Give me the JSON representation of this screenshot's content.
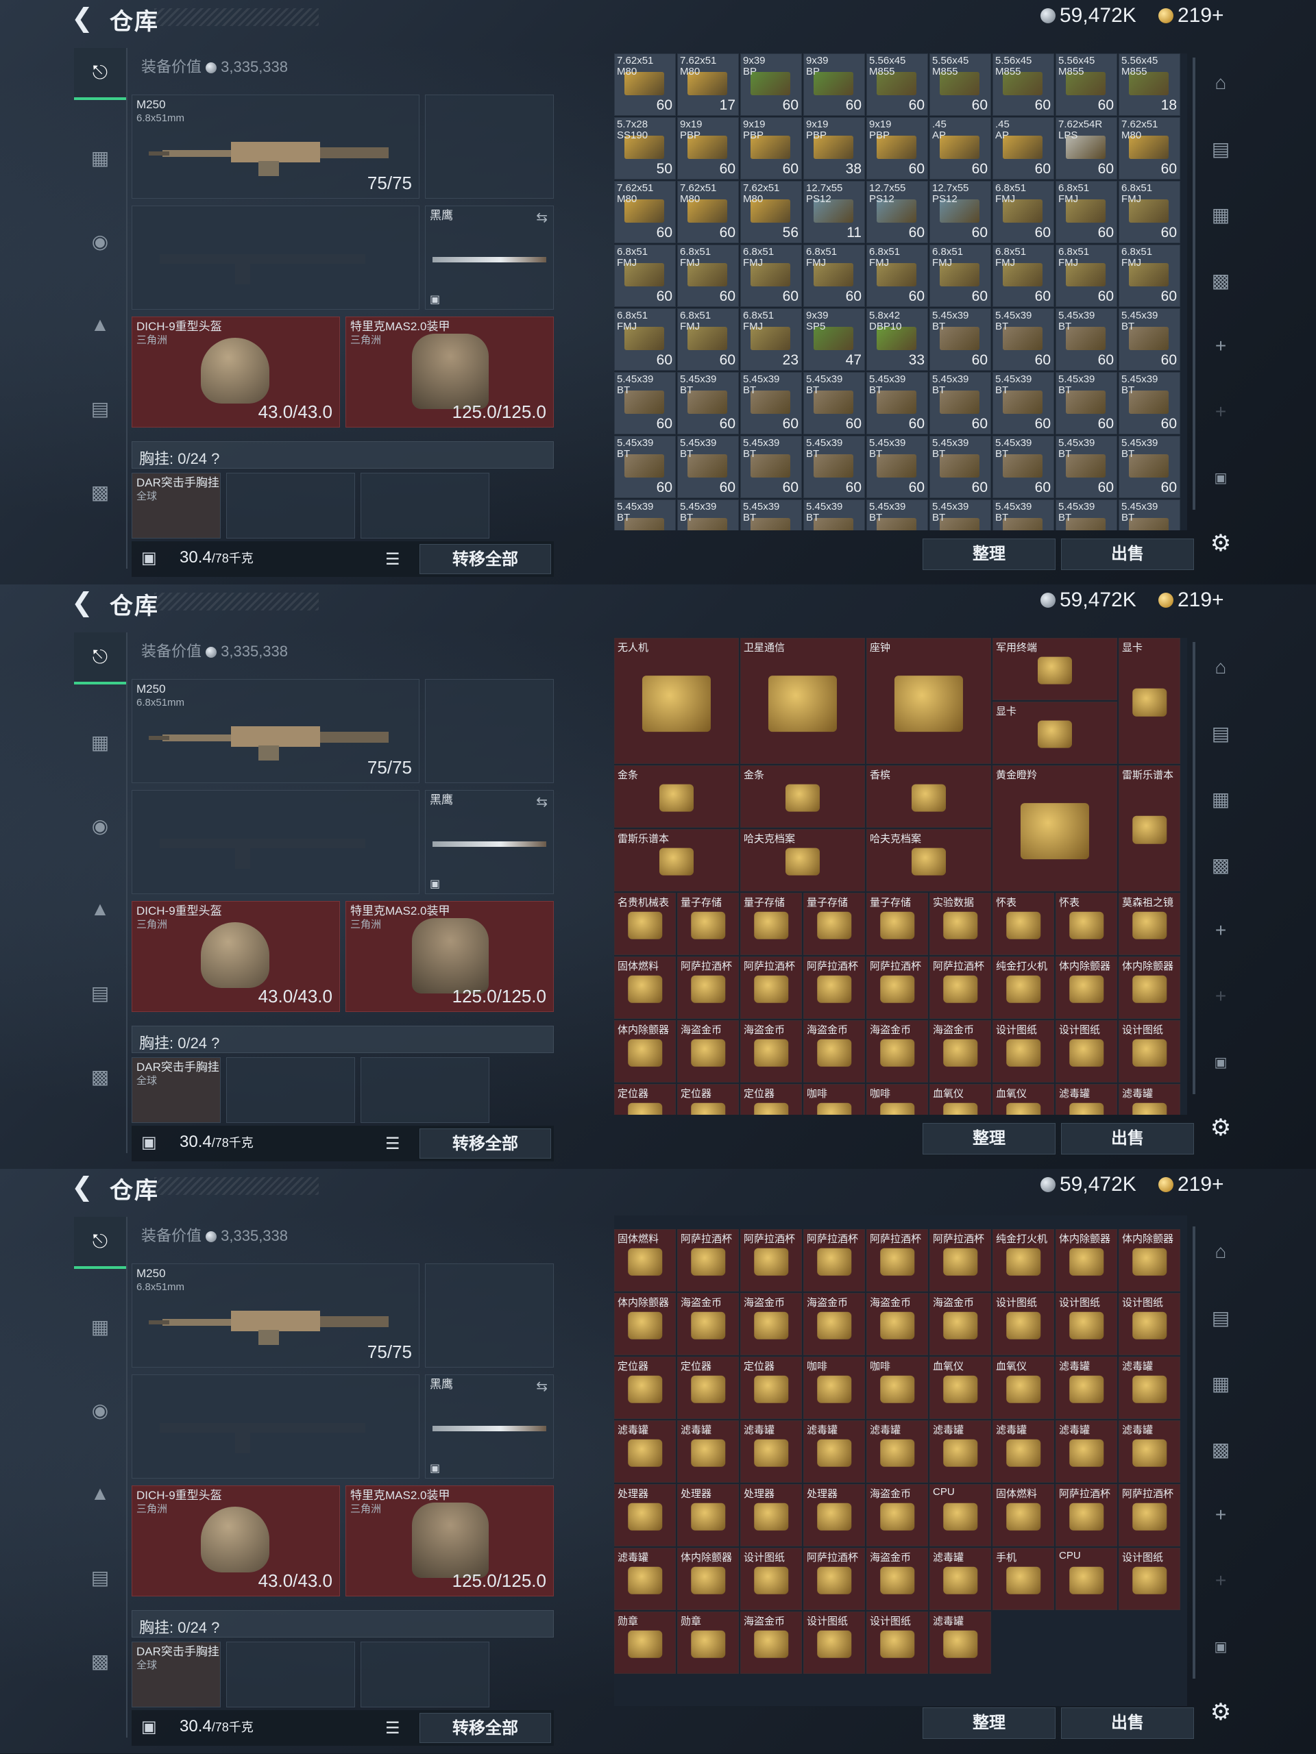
{
  "header": {
    "back_icon": "back-arrow-icon",
    "title": "仓库",
    "silver": "59,472K",
    "gold": "219+"
  },
  "equip": {
    "value_label": "装备价值",
    "value": "3,335,338",
    "primary": {
      "name": "M250",
      "caliber": "6.8x51mm",
      "ammo": "75/75"
    },
    "melee": {
      "name": "黑鹰"
    },
    "helmet": {
      "name": "DICH-9重型头盔",
      "region": "三角洲",
      "durability": "43.0/43.0"
    },
    "armor": {
      "name": "特里克MAS2.0装甲",
      "region": "三角洲",
      "durability": "125.0/125.0"
    },
    "chest_rig": "胸挂: 0/24",
    "chest_help": "?",
    "rig_item": {
      "name": "DAR突击手胸挂",
      "region": "全球"
    },
    "weight": "30.4",
    "weight_max": "/78千克",
    "transfer_all": "转移全部"
  },
  "actions": {
    "sort": "整理",
    "sell": "出售"
  },
  "ammo_grid": [
    [
      "7.62x51",
      "M80",
      60
    ],
    [
      "7.62x51",
      "M80",
      17
    ],
    [
      "9x39",
      "BP",
      60
    ],
    [
      "9x39",
      "BP",
      60
    ],
    [
      "5.56x45",
      "M855",
      60
    ],
    [
      "5.56x45",
      "M855",
      60
    ],
    [
      "5.56x45",
      "M855",
      60
    ],
    [
      "5.56x45",
      "M855",
      60
    ],
    [
      "5.56x45",
      "M855",
      18
    ],
    [
      "5.7x28",
      "SS190",
      50
    ],
    [
      "9x19",
      "PBP",
      60
    ],
    [
      "9x19",
      "PBP",
      60
    ],
    [
      "9x19",
      "PBP",
      38
    ],
    [
      "9x19",
      "PBP",
      60
    ],
    [
      ".45",
      "AP",
      60
    ],
    [
      ".45",
      "AP",
      60
    ],
    [
      "7.62x54R",
      "LPS",
      60
    ],
    [
      "7.62x51",
      "M80",
      60
    ],
    [
      "7.62x51",
      "M80",
      60
    ],
    [
      "7.62x51",
      "M80",
      60
    ],
    [
      "7.62x51",
      "M80",
      56
    ],
    [
      "12.7x55",
      "PS12",
      11
    ],
    [
      "12.7x55",
      "PS12",
      60
    ],
    [
      "12.7x55",
      "PS12",
      60
    ],
    [
      "6.8x51",
      "FMJ",
      60
    ],
    [
      "6.8x51",
      "FMJ",
      60
    ],
    [
      "6.8x51",
      "FMJ",
      60
    ],
    [
      "6.8x51",
      "FMJ",
      60
    ],
    [
      "6.8x51",
      "FMJ",
      60
    ],
    [
      "6.8x51",
      "FMJ",
      60
    ],
    [
      "6.8x51",
      "FMJ",
      60
    ],
    [
      "6.8x51",
      "FMJ",
      60
    ],
    [
      "6.8x51",
      "FMJ",
      60
    ],
    [
      "6.8x51",
      "FMJ",
      60
    ],
    [
      "6.8x51",
      "FMJ",
      60
    ],
    [
      "6.8x51",
      "FMJ",
      60
    ],
    [
      "6.8x51",
      "FMJ",
      60
    ],
    [
      "6.8x51",
      "FMJ",
      60
    ],
    [
      "6.8x51",
      "FMJ",
      23
    ],
    [
      "9x39",
      "SP5",
      47
    ],
    [
      "5.8x42",
      "DBP10",
      33
    ],
    [
      "5.45x39",
      "BT",
      60
    ],
    [
      "5.45x39",
      "BT",
      60
    ],
    [
      "5.45x39",
      "BT",
      60
    ],
    [
      "5.45x39",
      "BT",
      60
    ],
    [
      "5.45x39",
      "BT",
      60
    ],
    [
      "5.45x39",
      "BT",
      60
    ],
    [
      "5.45x39",
      "BT",
      60
    ],
    [
      "5.45x39",
      "BT",
      60
    ],
    [
      "5.45x39",
      "BT",
      60
    ],
    [
      "5.45x39",
      "BT",
      60
    ],
    [
      "5.45x39",
      "BT",
      60
    ],
    [
      "5.45x39",
      "BT",
      60
    ],
    [
      "5.45x39",
      "BT",
      60
    ],
    [
      "5.45x39",
      "BT",
      60
    ],
    [
      "5.45x39",
      "BT",
      60
    ],
    [
      "5.45x39",
      "BT",
      60
    ],
    [
      "5.45x39",
      "BT",
      60
    ],
    [
      "5.45x39",
      "BT",
      60
    ],
    [
      "5.45x39",
      "BT",
      60
    ],
    [
      "5.45x39",
      "BT",
      60
    ],
    [
      "5.45x39",
      "BT",
      60
    ],
    [
      "5.45x39",
      "BT",
      60
    ],
    [
      "5.45x39",
      "BT",
      ""
    ],
    [
      "5.45x39",
      "BT",
      ""
    ],
    [
      "5.45x39",
      "BT",
      ""
    ],
    [
      "5.45x39",
      "BT",
      ""
    ],
    [
      "5.45x39",
      "BT",
      ""
    ],
    [
      "5.45x39",
      "BT",
      ""
    ],
    [
      "5.45x39",
      "BT",
      ""
    ],
    [
      "5.45x39",
      "BT",
      ""
    ],
    [
      "5.45x39",
      "BT",
      ""
    ]
  ],
  "loot_big": [
    "无人机",
    "卫星通信",
    "座钟",
    "军用终端",
    "显卡",
    "显卡",
    "金条",
    "金条",
    "香槟",
    "黄金瞪羚",
    "雷斯乐谱本",
    "雷斯乐谱本",
    "哈夫克档案",
    "哈夫克档案"
  ],
  "loot_rows_2": [
    [
      "名贵机械表",
      "量子存储",
      "量子存储",
      "量子存储",
      "量子存储",
      "实验数据",
      "怀表",
      "怀表",
      "莫森祖之镜"
    ],
    [
      "固体燃料",
      "阿萨拉酒杯",
      "阿萨拉酒杯",
      "阿萨拉酒杯",
      "阿萨拉酒杯",
      "阿萨拉酒杯",
      "纯金打火机",
      "体内除颤器",
      "体内除颤器"
    ],
    [
      "体内除颤器",
      "海盗金币",
      "海盗金币",
      "海盗金币",
      "海盗金币",
      "海盗金币",
      "设计图纸",
      "设计图纸",
      "设计图纸"
    ],
    [
      "定位器",
      "定位器",
      "定位器",
      "咖啡",
      "咖啡",
      "血氧仪",
      "血氧仪",
      "滤毒罐",
      "滤毒罐"
    ]
  ],
  "loot_rows_3": [
    [
      "固体燃料",
      "阿萨拉酒杯",
      "阿萨拉酒杯",
      "阿萨拉酒杯",
      "阿萨拉酒杯",
      "阿萨拉酒杯",
      "纯金打火机",
      "体内除颤器",
      "体内除颤器"
    ],
    [
      "体内除颤器",
      "海盗金币",
      "海盗金币",
      "海盗金币",
      "海盗金币",
      "海盗金币",
      "设计图纸",
      "设计图纸",
      "设计图纸"
    ],
    [
      "定位器",
      "定位器",
      "定位器",
      "咖啡",
      "咖啡",
      "血氧仪",
      "血氧仪",
      "滤毒罐",
      "滤毒罐"
    ],
    [
      "滤毒罐",
      "滤毒罐",
      "滤毒罐",
      "滤毒罐",
      "滤毒罐",
      "滤毒罐",
      "滤毒罐",
      "滤毒罐",
      "滤毒罐"
    ],
    [
      "处理器",
      "处理器",
      "处理器",
      "处理器",
      "海盗金币",
      "CPU",
      "固体燃料",
      "阿萨拉酒杯",
      "阿萨拉酒杯"
    ],
    [
      "滤毒罐",
      "体内除颤器",
      "设计图纸",
      "阿萨拉酒杯",
      "海盗金币",
      "滤毒罐",
      "手机",
      "CPU",
      "设计图纸"
    ],
    [
      "勋章",
      "勋章",
      "海盗金币",
      "设计图纸",
      "设计图纸",
      "滤毒罐"
    ]
  ],
  "colors": {
    "accent_green": "#3dd08a",
    "slot_red": "#5a2428",
    "loot_red": "#4a2226",
    "ammo_bg": "#3a4656"
  }
}
